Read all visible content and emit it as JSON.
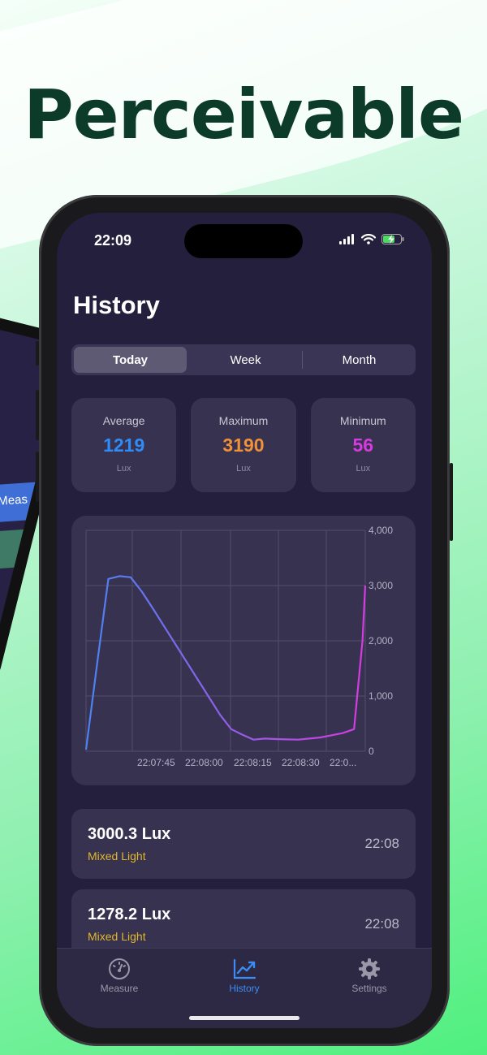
{
  "headline": "Perceivable",
  "back_phone": {
    "button_text": "rt Meas"
  },
  "status_bar": {
    "time": "22:09",
    "icons": [
      "signal-icon",
      "wifi-icon",
      "battery-charging-icon"
    ]
  },
  "screen": {
    "title": "History",
    "segments": [
      {
        "label": "Today",
        "selected": true
      },
      {
        "label": "Week",
        "selected": false
      },
      {
        "label": "Month",
        "selected": false
      }
    ],
    "stats": [
      {
        "label": "Average",
        "value": "1219",
        "unit": "Lux",
        "color": "#2f8cf7"
      },
      {
        "label": "Maximum",
        "value": "3190",
        "unit": "Lux",
        "color": "#f0913a"
      },
      {
        "label": "Minimum",
        "value": "56",
        "unit": "Lux",
        "color": "#d63be0"
      }
    ],
    "records": [
      {
        "lux": "3000.3 Lux",
        "type": "Mixed Light",
        "time": "22:08"
      },
      {
        "lux": "1278.2 Lux",
        "type": "Mixed Light",
        "time": "22:08"
      }
    ],
    "tabs": [
      {
        "label": "Measure",
        "icon": "gauge-icon",
        "active": false
      },
      {
        "label": "History",
        "icon": "chart-line-icon",
        "active": true
      },
      {
        "label": "Settings",
        "icon": "gear-icon",
        "active": false
      }
    ]
  },
  "chart_data": {
    "type": "line",
    "x_tick_labels": [
      "22:07:45",
      "22:08:00",
      "22:08:15",
      "22:08:30",
      "22:0..."
    ],
    "y_tick_labels": [
      "4,000",
      "3,000",
      "2,000",
      "1,000",
      "0"
    ],
    "ylim": [
      0,
      4000
    ],
    "gradient": [
      "#4a83f2",
      "#d63be0"
    ],
    "series": [
      {
        "x": [
          0,
          4,
          8,
          12,
          16,
          20,
          24,
          28,
          32,
          36,
          40,
          44,
          48,
          52,
          56,
          60,
          64,
          68,
          72,
          76,
          80,
          84,
          88,
          92,
          96,
          99,
          100
        ],
        "y": [
          30,
          1600,
          3120,
          3170,
          3150,
          2890,
          2580,
          2260,
          1940,
          1620,
          1300,
          980,
          660,
          400,
          300,
          210,
          230,
          220,
          215,
          210,
          230,
          250,
          290,
          330,
          400,
          2000,
          3000
        ]
      }
    ]
  }
}
